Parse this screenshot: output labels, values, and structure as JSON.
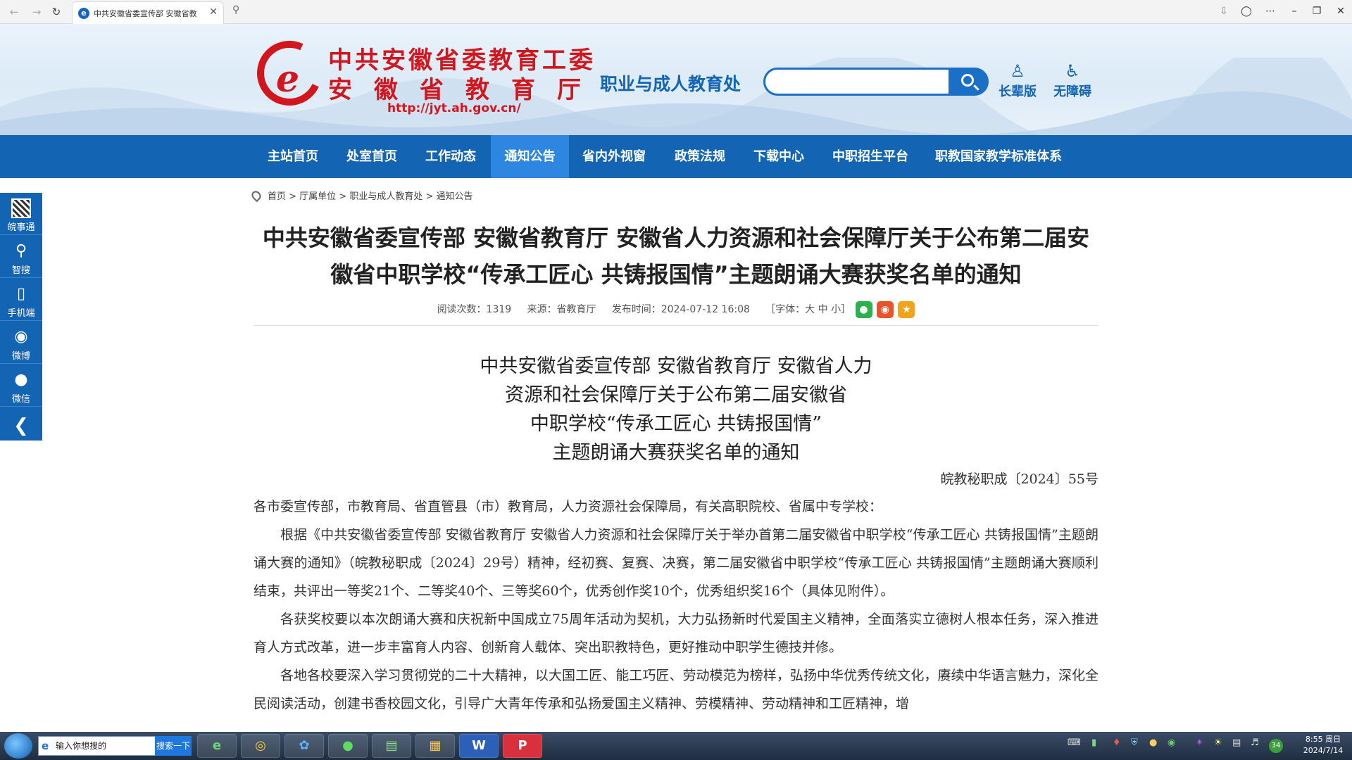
{
  "browser": {
    "tab_title": "中共安徽省委宣传部 安徽省教",
    "tab_favicon": "e"
  },
  "header": {
    "org_line1": "中共安徽省委教育工委",
    "org_line2": "安徽省教育厅",
    "url": "http://jyt.ah.gov.cn/",
    "dept": "职业与成人教育处",
    "search_placeholder": "",
    "links": [
      {
        "label": "长辈版",
        "icon": "elder-icon"
      },
      {
        "label": "无障碍",
        "icon": "accessibility-icon"
      }
    ]
  },
  "nav": [
    {
      "label": "主站首页",
      "active": false
    },
    {
      "label": "处室首页",
      "active": false
    },
    {
      "label": "工作动态",
      "active": false
    },
    {
      "label": "通知公告",
      "active": true
    },
    {
      "label": "省内外视窗",
      "active": false
    },
    {
      "label": "政策法规",
      "active": false
    },
    {
      "label": "下载中心",
      "active": false
    },
    {
      "label": "中职招生平台",
      "active": false
    },
    {
      "label": "职教国家教学标准体系",
      "active": false
    }
  ],
  "floatbar": [
    {
      "label": "皖事通"
    },
    {
      "label": "智搜"
    },
    {
      "label": "手机端"
    },
    {
      "label": "微博"
    },
    {
      "label": "微信"
    }
  ],
  "breadcrumb": "首页 > 厅属单位 > 职业与成人教育处 > 通知公告",
  "article": {
    "title_line1": "中共安徽省委宣传部 安徽省教育厅 安徽省人力资源和社会保障厅关于公布第二届安",
    "title_line2": "徽省中职学校“传承工匠心 共铸报国情”主题朗诵大赛获奖名单的通知",
    "meta_reads": "阅读次数：1319",
    "meta_source": "来源：省教育厅",
    "meta_time": "发布时间：2024-07-12 16:08",
    "meta_font": "［字体：大 中 小］",
    "doc_title_lines": [
      "中共安徽省委宣传部 安徽省教育厅 安徽省人力",
      "资源和社会保障厅关于公布第二届安徽省",
      "中职学校“传承工匠心 共铸报国情”",
      "主题朗诵大赛获奖名单的通知"
    ],
    "doc_number": "皖教秘职成〔2024〕55号",
    "salutation": "各市委宣传部，市教育局、省直管县（市）教育局，人力资源社会保障局，有关高职院校、省属中专学校：",
    "para1": "根据《中共安徽省委宣传部 安徽省教育厅 安徽省人力资源和社会保障厅关于举办首第二届安徽省中职学校“传承工匠心 共铸报国情”主题朗诵大赛的通知》（皖教秘职成〔2024〕29号）精神，经初赛、复赛、决赛，第二届安徽省中职学校“传承工匠心 共铸报国情”主题朗诵大赛顺利结束，共评出一等奖21个、二等奖40个、三等奖60个，优秀创作奖10个，优秀组织奖16个（具体见附件）。",
    "para2": "各获奖校要以本次朗诵大赛和庆祝新中国成立75周年活动为契机，大力弘扬新时代爱国主义精神，全面落实立德树人根本任务，深入推进育人方式改革，进一步丰富育人内容、创新育人载体、突出职教特色，更好推动中职学生德技并修。",
    "para3": "各地各校要深入学习贯彻党的二十大精神，以大国工匠、能工巧匠、劳动模范为榜样，弘扬中华优秀传统文化，赓续中华语言魅力，深化全民阅读活动，创建书香校园文化，引导广大青年传承和弘扬爱国主义精神、劳模精神、劳动精神和工匠精神，增"
  },
  "taskbar": {
    "search_placeholder": "输入你想搜的",
    "search_button": "搜索一下",
    "clock_time": "8:55 周日",
    "clock_date": "2024/7/14",
    "tray_badge": "34"
  },
  "colors": {
    "brand_blue": "#1464b4",
    "brand_red": "#d2161e",
    "nav_active": "#2d87e0"
  }
}
